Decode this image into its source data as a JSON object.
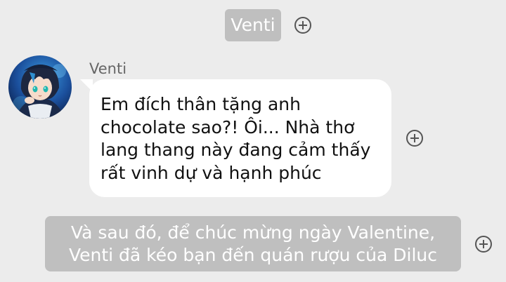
{
  "header": {
    "character_name": "Venti"
  },
  "message": {
    "sender": "Venti",
    "lines": [
      "Em đích thân tặng anh",
      "chocolate sao?! Ôi... Nhà thơ",
      "lang thang này đang cảm thấy",
      "rất vinh dự và hạnh phúc"
    ]
  },
  "narration": {
    "lines": [
      "Và sau đó, để chúc mừng ngày Valentine,",
      "Venti đã kéo bạn đến quán rượu của Diluc"
    ]
  },
  "icons": {
    "add": "plus-circle-icon",
    "avatar": "avatar-venti"
  },
  "colors": {
    "background": "#ececec",
    "chip": "#bfbfbf",
    "bubble": "#ffffff",
    "avatar_accent": "#1e5fb4"
  }
}
